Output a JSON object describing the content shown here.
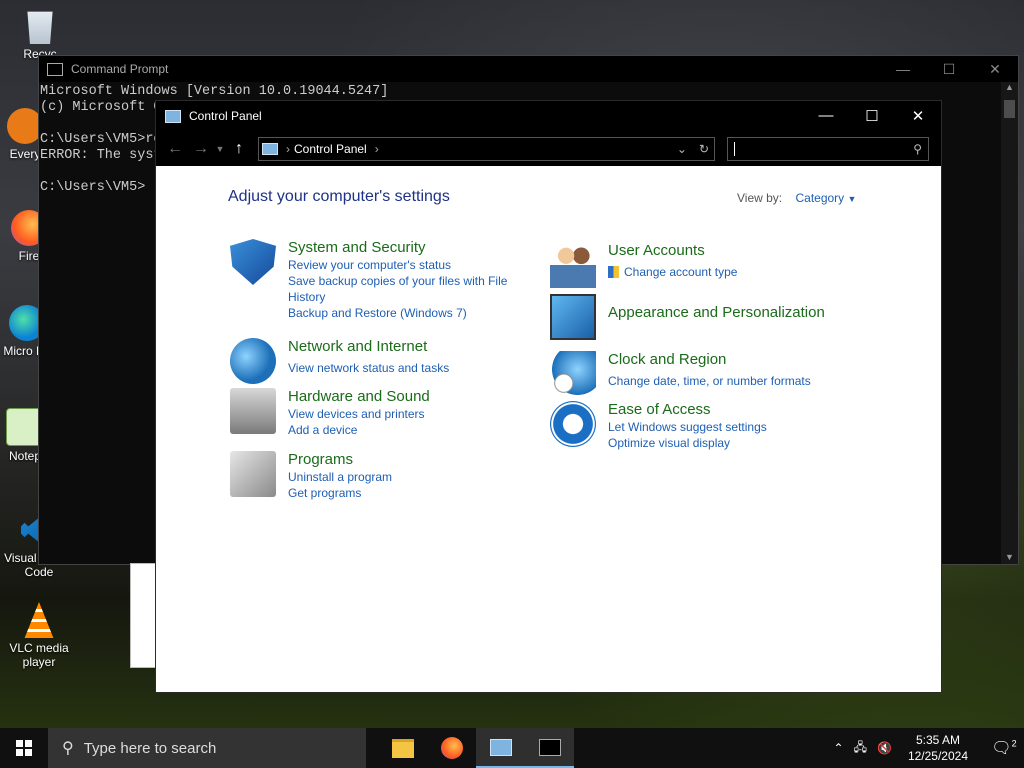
{
  "desktop": {
    "icons": [
      {
        "label": "Recyc",
        "icon": "recycle-bin-icon"
      },
      {
        "label": "Every",
        "icon": "everything-icon"
      },
      {
        "label": "Fire",
        "icon": "firefox-icon"
      },
      {
        "label": "Micro Ed",
        "icon": "edge-icon"
      },
      {
        "label": "Notep",
        "icon": "notepad-icon"
      },
      {
        "label": "Visual Studio Code",
        "icon": "vscode-icon"
      },
      {
        "label": "VLC media player",
        "icon": "vlc-icon"
      }
    ]
  },
  "cmd": {
    "title": "Command Prompt",
    "lines": "Microsoft Windows [Version 10.0.19044.5247]\n(c) Microsoft C\n\nC:\\Users\\VM5>re\nERROR: The syst\n\nC:\\Users\\VM5>"
  },
  "control_panel": {
    "title": "Control Panel",
    "address": "Control Panel",
    "heading": "Adjust your computer's settings",
    "view_by_label": "View by:",
    "view_by_value": "Category",
    "left": [
      {
        "title": "System and Security",
        "links": [
          "Review your computer's status",
          "Save backup copies of your files with File History",
          "Backup and Restore (Windows 7)"
        ]
      },
      {
        "title": "Network and Internet",
        "links": [
          "View network status and tasks"
        ]
      },
      {
        "title": "Hardware and Sound",
        "links": [
          "View devices and printers",
          "Add a device"
        ]
      },
      {
        "title": "Programs",
        "links": [
          "Uninstall a program",
          "Get programs"
        ]
      }
    ],
    "right": [
      {
        "title": "User Accounts",
        "links": [
          "Change account type"
        ]
      },
      {
        "title": "Appearance and Personalization",
        "links": []
      },
      {
        "title": "Clock and Region",
        "links": [
          "Change date, time, or number formats"
        ]
      },
      {
        "title": "Ease of Access",
        "links": [
          "Let Windows suggest settings",
          "Optimize visual display"
        ]
      }
    ]
  },
  "taskbar": {
    "search_placeholder": "Type here to search",
    "time": "5:35 AM",
    "date": "12/25/2024",
    "notification_count": "2"
  }
}
